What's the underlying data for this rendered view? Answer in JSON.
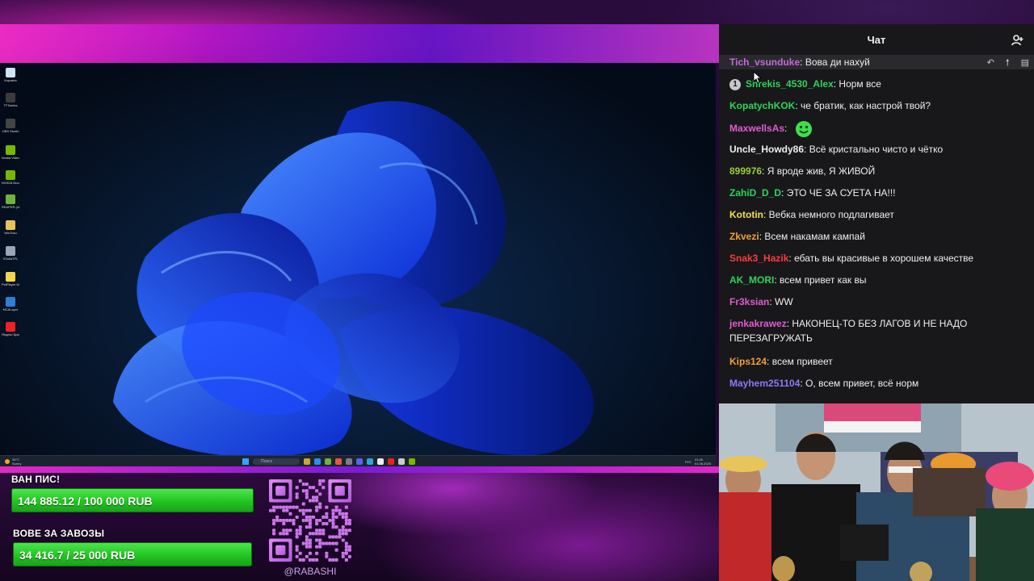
{
  "desktop": {
    "icons": [
      {
        "label": "Корзина",
        "icon": "recycle-bin-icon",
        "color": "#cfe3f5"
      },
      {
        "label": "TFTactics",
        "icon": "tft-icon",
        "color": "#3b3b3b"
      },
      {
        "label": "OBS Studio",
        "icon": "obs-icon",
        "color": "#444"
      },
      {
        "label": "Nvidia Video",
        "icon": "nvidia-icon",
        "color": "#76b900"
      },
      {
        "label": "NVIDIA Broadcast",
        "icon": "nvidia-broadcast-icon",
        "color": "#76b900"
      },
      {
        "label": "REAPER (x64)",
        "icon": "reaper-icon",
        "color": "#6fb23f"
      },
      {
        "label": "WinTosu",
        "icon": "app-icon",
        "color": "#e6c25a"
      },
      {
        "label": "XSollaTPL",
        "icon": "app-icon",
        "color": "#9aa6b8"
      },
      {
        "label": "PotPlayer 64 bit",
        "icon": "potplayer-icon",
        "color": "#f2d64b"
      },
      {
        "label": "NCALayer",
        "icon": "ncalayer-icon",
        "color": "#2f7fd6"
      },
      {
        "label": "Яндекс Браузер",
        "icon": "yandex-browser-icon",
        "color": "#e22"
      }
    ],
    "taskbar": {
      "weather_temp": "34°C",
      "weather_desc": "Sunny",
      "search_placeholder": "Поиск",
      "lang": "РУС",
      "time": "21:40",
      "date": "01.08.2025"
    }
  },
  "goals": [
    {
      "title": "ВАН ПИС!",
      "amount": "144 885.12 / 100 000 RUB",
      "progress": 1.0
    },
    {
      "title": "ВОВЕ ЗА ЗАВОЗЫ",
      "amount": "34 416.7 / 25 000 RUB",
      "progress": 1.0
    }
  ],
  "qr": {
    "handle": "@RABASHI"
  },
  "chat": {
    "title": "Чат",
    "messages": [
      {
        "user": "Tich_vsunduke",
        "color": "#c36bd8",
        "text": "Вова ди нахуй",
        "highlight": true
      },
      {
        "user": "Shrekis_4530_Alex",
        "color": "#2ed35b",
        "text": "Норм все",
        "badge": "1"
      },
      {
        "user": "KopatychKOK",
        "color": "#2ed35b",
        "text": "че братик, как настрой твой?"
      },
      {
        "user": "MaxwellsAs",
        "color": "#e05bd2",
        "text": "",
        "emote": "smile-emote-icon"
      },
      {
        "user": "Uncle_Howdy86",
        "color": "#efeff1",
        "text": "Всё кристально чисто и чётко"
      },
      {
        "user": "899976",
        "color": "#9acd32",
        "text": "Я вроде жив, Я ЖИВОЙ"
      },
      {
        "user": "ZahiD_D_D",
        "color": "#2ed35b",
        "text": "ЭТО ЧЕ ЗА СУЕТА НА!!!"
      },
      {
        "user": "Kototin",
        "color": "#f0e14a",
        "text": "Вебка немного подлагивает"
      },
      {
        "user": "Zkvezi",
        "color": "#f0a03a",
        "text": "Всем накамам кампай"
      },
      {
        "user": "Snak3_Hazik",
        "color": "#ff3b3b",
        "text": "ебать вы красивые в хорошем качестве"
      },
      {
        "user": "AK_MORI",
        "color": "#2ed35b",
        "text": "всем привет как вы"
      },
      {
        "user": "Fr3ksian",
        "color": "#e05bd2",
        "text": "WW"
      },
      {
        "user": "jenkakrawez",
        "color": "#e05bd2",
        "text": "НАКОНЕЦ-ТО БЕЗ ЛАГОВ И НЕ НАДО ПЕРЕЗАГРУЖАТЬ"
      },
      {
        "user": "Kips124",
        "color": "#f0a03a",
        "text": "всем привеет"
      },
      {
        "user": "Mayhem251104",
        "color": "#8a7cf5",
        "text": "О, всем привет, всё норм"
      }
    ]
  }
}
